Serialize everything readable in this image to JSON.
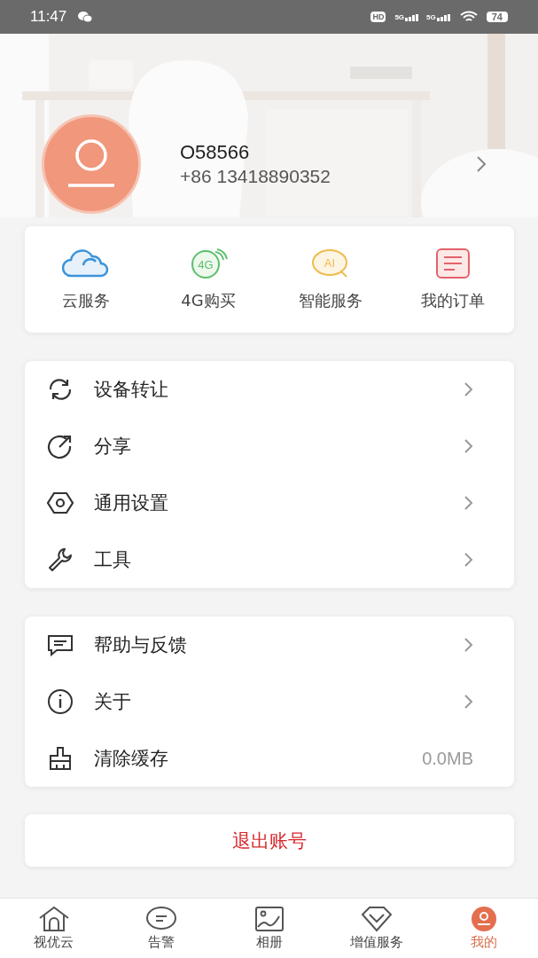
{
  "status_bar": {
    "time": "11:47",
    "hd": "HD",
    "networks": [
      "5G",
      "5G"
    ],
    "battery": "74"
  },
  "profile": {
    "name": "O58566",
    "phone": "+86 13418890352"
  },
  "quick_actions": [
    {
      "label": "云服务"
    },
    {
      "label": "4G购买",
      "icon_text": "4G"
    },
    {
      "label": "智能服务",
      "icon_text": "AI"
    },
    {
      "label": "我的订单"
    }
  ],
  "menu_groups": [
    {
      "items": [
        {
          "kind": "link",
          "label": "设备转让"
        },
        {
          "kind": "link",
          "label": "分享"
        },
        {
          "kind": "link",
          "label": "通用设置"
        },
        {
          "kind": "link",
          "label": "工具"
        }
      ]
    },
    {
      "items": [
        {
          "kind": "link",
          "label": "帮助与反馈"
        },
        {
          "kind": "link",
          "label": "关于"
        },
        {
          "kind": "value",
          "label": "清除缓存",
          "value": "0.0MB"
        }
      ]
    }
  ],
  "logout": {
    "label": "退出账号"
  },
  "tabs": [
    {
      "label": "视优云",
      "selected": false
    },
    {
      "label": "告警",
      "selected": false
    },
    {
      "label": "相册",
      "selected": false
    },
    {
      "label": "增值服务",
      "selected": false
    },
    {
      "label": "我的",
      "selected": true
    }
  ]
}
